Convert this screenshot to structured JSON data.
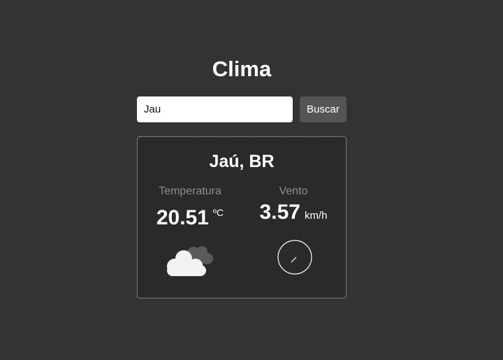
{
  "app": {
    "title": "Clima"
  },
  "search": {
    "value": "Jau",
    "placeholder": "",
    "button_label": "Buscar"
  },
  "weather": {
    "location": "Jaú, BR",
    "temperature": {
      "label": "Temperatura",
      "value": "20.51",
      "unit": "ºC"
    },
    "wind": {
      "label": "Vento",
      "value": "3.57",
      "unit": "km/h"
    },
    "condition_icon": "cloud-icon",
    "wind_direction_icon": "compass-icon"
  },
  "colors": {
    "background": "#333333",
    "card_background": "#2a2a2a",
    "card_border": "#cfcfcf",
    "button_background": "#555555",
    "label_muted": "#8e8e8e",
    "text": "#ffffff"
  }
}
